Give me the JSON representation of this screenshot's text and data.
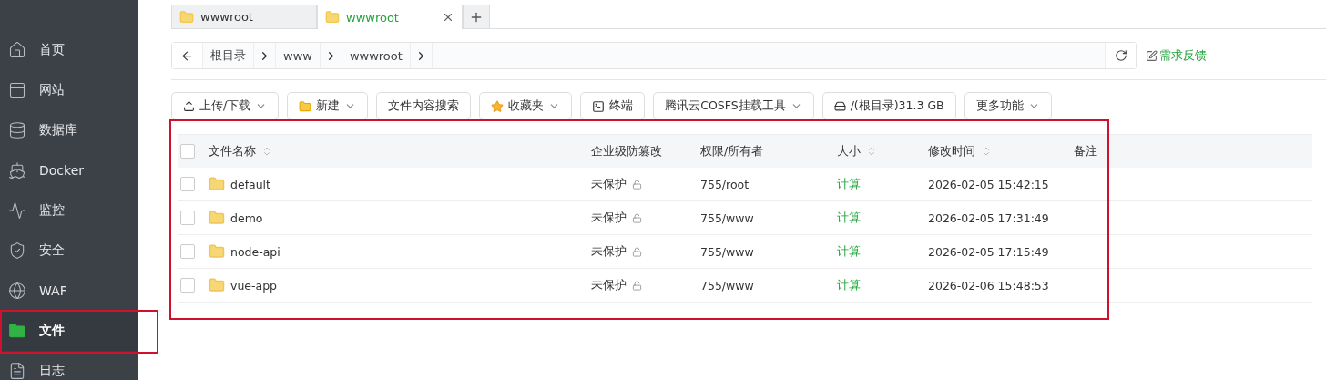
{
  "sidebar": {
    "items": [
      {
        "label": "首页",
        "selected": false,
        "highlighted": false
      },
      {
        "label": "网站",
        "selected": false,
        "highlighted": false
      },
      {
        "label": "数据库",
        "selected": false,
        "highlighted": false
      },
      {
        "label": "Docker",
        "selected": false,
        "highlighted": false
      },
      {
        "label": "监控",
        "selected": false,
        "highlighted": false
      },
      {
        "label": "安全",
        "selected": false,
        "highlighted": false
      },
      {
        "label": "WAF",
        "selected": false,
        "highlighted": false
      },
      {
        "label": "文件",
        "selected": true,
        "highlighted": true
      },
      {
        "label": "日志",
        "selected": false,
        "highlighted": false
      }
    ]
  },
  "tabs": [
    {
      "label": "wwwroot",
      "selected": false,
      "closable": false
    },
    {
      "label": "wwwroot",
      "selected": true,
      "closable": true
    }
  ],
  "breadcrumb": {
    "segments": [
      "根目录",
      "www",
      "wwwroot"
    ]
  },
  "feedback": "需求反馈",
  "toolbar": [
    {
      "label": "上传/下载",
      "dropdown": true
    },
    {
      "label": "新建",
      "dropdown": true
    },
    {
      "label": "文件内容搜索",
      "dropdown": false
    },
    {
      "label": "收藏夹",
      "dropdown": true
    },
    {
      "label": "终端",
      "dropdown": false
    },
    {
      "label": "腾讯云COSFS挂载工具",
      "dropdown": true
    },
    {
      "label": "/(根目录)31.3 GB",
      "dropdown": false
    },
    {
      "label": "更多功能",
      "dropdown": true
    }
  ],
  "table": {
    "highlighted": true,
    "all_checked": false,
    "columns": [
      {
        "label": "文件名称",
        "sortable": true
      },
      {
        "label": "企业级防篡改",
        "sortable": false
      },
      {
        "label": "权限/所有者",
        "sortable": false
      },
      {
        "label": "大小",
        "sortable": true
      },
      {
        "label": "修改时间",
        "sortable": true
      },
      {
        "label": "备注",
        "sortable": false
      }
    ],
    "rows": [
      {
        "name": "default",
        "protection": "未保护",
        "permissions": "755/root",
        "size": "计算",
        "modified": "2026-02-05 15:42:15",
        "checked": false
      },
      {
        "name": "demo",
        "protection": "未保护",
        "permissions": "755/www",
        "size": "计算",
        "modified": "2026-02-05 17:31:49",
        "checked": false
      },
      {
        "name": "node-api",
        "protection": "未保护",
        "permissions": "755/www",
        "size": "计算",
        "modified": "2026-02-05 17:15:49",
        "checked": false
      },
      {
        "name": "vue-app",
        "protection": "未保护",
        "permissions": "755/www",
        "size": "计算",
        "modified": "2026-02-06 15:48:53",
        "checked": false
      }
    ]
  }
}
